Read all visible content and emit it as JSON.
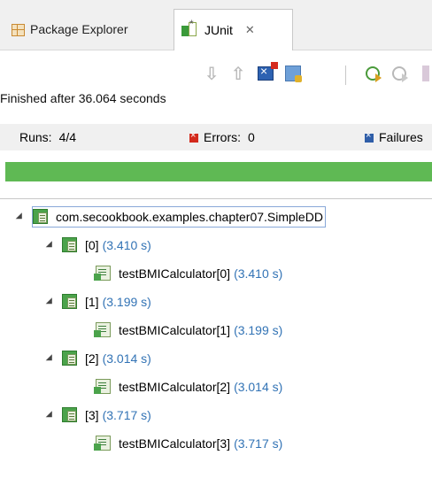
{
  "tabs": {
    "package_explorer": "Package Explorer",
    "junit": "JUnit"
  },
  "status": "Finished after 36.064 seconds",
  "counters": {
    "runs_label": "Runs:",
    "runs_value": "4/4",
    "errors_label": "Errors:",
    "errors_value": "0",
    "failures_label": "Failures"
  },
  "progress": {
    "percent": 100,
    "color": "#5fb954"
  },
  "tree": {
    "root_label": "com.secookbook.examples.chapter07.SimpleDD",
    "groups": [
      {
        "label": "[0]",
        "duration": "(3.410 s)",
        "test": "testBMICalculator[0]",
        "test_duration": "(3.410 s)"
      },
      {
        "label": "[1]",
        "duration": "(3.199 s)",
        "test": "testBMICalculator[1]",
        "test_duration": "(3.199 s)"
      },
      {
        "label": "[2]",
        "duration": "(3.014 s)",
        "test": "testBMICalculator[2]",
        "test_duration": "(3.014 s)"
      },
      {
        "label": "[3]",
        "duration": "(3.717 s)",
        "test": "testBMICalculator[3]",
        "test_duration": "(3.717 s)"
      }
    ]
  },
  "colors": {
    "duration": "#3273b5",
    "accent_green": "#5fb954"
  }
}
